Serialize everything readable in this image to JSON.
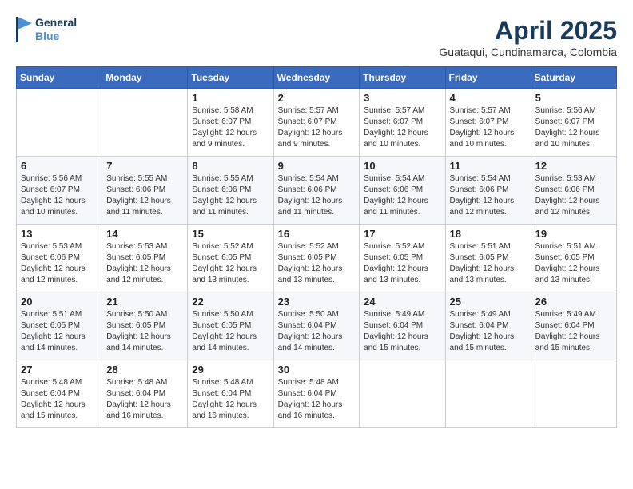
{
  "header": {
    "logo_line1": "General",
    "logo_line2": "Blue",
    "month_year": "April 2025",
    "location": "Guataqui, Cundinamarca, Colombia"
  },
  "weekdays": [
    "Sunday",
    "Monday",
    "Tuesday",
    "Wednesday",
    "Thursday",
    "Friday",
    "Saturday"
  ],
  "weeks": [
    [
      {
        "day": "",
        "sunrise": "",
        "sunset": "",
        "daylight": ""
      },
      {
        "day": "",
        "sunrise": "",
        "sunset": "",
        "daylight": ""
      },
      {
        "day": "1",
        "sunrise": "Sunrise: 5:58 AM",
        "sunset": "Sunset: 6:07 PM",
        "daylight": "Daylight: 12 hours and 9 minutes."
      },
      {
        "day": "2",
        "sunrise": "Sunrise: 5:57 AM",
        "sunset": "Sunset: 6:07 PM",
        "daylight": "Daylight: 12 hours and 9 minutes."
      },
      {
        "day": "3",
        "sunrise": "Sunrise: 5:57 AM",
        "sunset": "Sunset: 6:07 PM",
        "daylight": "Daylight: 12 hours and 10 minutes."
      },
      {
        "day": "4",
        "sunrise": "Sunrise: 5:57 AM",
        "sunset": "Sunset: 6:07 PM",
        "daylight": "Daylight: 12 hours and 10 minutes."
      },
      {
        "day": "5",
        "sunrise": "Sunrise: 5:56 AM",
        "sunset": "Sunset: 6:07 PM",
        "daylight": "Daylight: 12 hours and 10 minutes."
      }
    ],
    [
      {
        "day": "6",
        "sunrise": "Sunrise: 5:56 AM",
        "sunset": "Sunset: 6:07 PM",
        "daylight": "Daylight: 12 hours and 10 minutes."
      },
      {
        "day": "7",
        "sunrise": "Sunrise: 5:55 AM",
        "sunset": "Sunset: 6:06 PM",
        "daylight": "Daylight: 12 hours and 11 minutes."
      },
      {
        "day": "8",
        "sunrise": "Sunrise: 5:55 AM",
        "sunset": "Sunset: 6:06 PM",
        "daylight": "Daylight: 12 hours and 11 minutes."
      },
      {
        "day": "9",
        "sunrise": "Sunrise: 5:54 AM",
        "sunset": "Sunset: 6:06 PM",
        "daylight": "Daylight: 12 hours and 11 minutes."
      },
      {
        "day": "10",
        "sunrise": "Sunrise: 5:54 AM",
        "sunset": "Sunset: 6:06 PM",
        "daylight": "Daylight: 12 hours and 11 minutes."
      },
      {
        "day": "11",
        "sunrise": "Sunrise: 5:54 AM",
        "sunset": "Sunset: 6:06 PM",
        "daylight": "Daylight: 12 hours and 12 minutes."
      },
      {
        "day": "12",
        "sunrise": "Sunrise: 5:53 AM",
        "sunset": "Sunset: 6:06 PM",
        "daylight": "Daylight: 12 hours and 12 minutes."
      }
    ],
    [
      {
        "day": "13",
        "sunrise": "Sunrise: 5:53 AM",
        "sunset": "Sunset: 6:06 PM",
        "daylight": "Daylight: 12 hours and 12 minutes."
      },
      {
        "day": "14",
        "sunrise": "Sunrise: 5:53 AM",
        "sunset": "Sunset: 6:05 PM",
        "daylight": "Daylight: 12 hours and 12 minutes."
      },
      {
        "day": "15",
        "sunrise": "Sunrise: 5:52 AM",
        "sunset": "Sunset: 6:05 PM",
        "daylight": "Daylight: 12 hours and 13 minutes."
      },
      {
        "day": "16",
        "sunrise": "Sunrise: 5:52 AM",
        "sunset": "Sunset: 6:05 PM",
        "daylight": "Daylight: 12 hours and 13 minutes."
      },
      {
        "day": "17",
        "sunrise": "Sunrise: 5:52 AM",
        "sunset": "Sunset: 6:05 PM",
        "daylight": "Daylight: 12 hours and 13 minutes."
      },
      {
        "day": "18",
        "sunrise": "Sunrise: 5:51 AM",
        "sunset": "Sunset: 6:05 PM",
        "daylight": "Daylight: 12 hours and 13 minutes."
      },
      {
        "day": "19",
        "sunrise": "Sunrise: 5:51 AM",
        "sunset": "Sunset: 6:05 PM",
        "daylight": "Daylight: 12 hours and 13 minutes."
      }
    ],
    [
      {
        "day": "20",
        "sunrise": "Sunrise: 5:51 AM",
        "sunset": "Sunset: 6:05 PM",
        "daylight": "Daylight: 12 hours and 14 minutes."
      },
      {
        "day": "21",
        "sunrise": "Sunrise: 5:50 AM",
        "sunset": "Sunset: 6:05 PM",
        "daylight": "Daylight: 12 hours and 14 minutes."
      },
      {
        "day": "22",
        "sunrise": "Sunrise: 5:50 AM",
        "sunset": "Sunset: 6:05 PM",
        "daylight": "Daylight: 12 hours and 14 minutes."
      },
      {
        "day": "23",
        "sunrise": "Sunrise: 5:50 AM",
        "sunset": "Sunset: 6:04 PM",
        "daylight": "Daylight: 12 hours and 14 minutes."
      },
      {
        "day": "24",
        "sunrise": "Sunrise: 5:49 AM",
        "sunset": "Sunset: 6:04 PM",
        "daylight": "Daylight: 12 hours and 15 minutes."
      },
      {
        "day": "25",
        "sunrise": "Sunrise: 5:49 AM",
        "sunset": "Sunset: 6:04 PM",
        "daylight": "Daylight: 12 hours and 15 minutes."
      },
      {
        "day": "26",
        "sunrise": "Sunrise: 5:49 AM",
        "sunset": "Sunset: 6:04 PM",
        "daylight": "Daylight: 12 hours and 15 minutes."
      }
    ],
    [
      {
        "day": "27",
        "sunrise": "Sunrise: 5:48 AM",
        "sunset": "Sunset: 6:04 PM",
        "daylight": "Daylight: 12 hours and 15 minutes."
      },
      {
        "day": "28",
        "sunrise": "Sunrise: 5:48 AM",
        "sunset": "Sunset: 6:04 PM",
        "daylight": "Daylight: 12 hours and 16 minutes."
      },
      {
        "day": "29",
        "sunrise": "Sunrise: 5:48 AM",
        "sunset": "Sunset: 6:04 PM",
        "daylight": "Daylight: 12 hours and 16 minutes."
      },
      {
        "day": "30",
        "sunrise": "Sunrise: 5:48 AM",
        "sunset": "Sunset: 6:04 PM",
        "daylight": "Daylight: 12 hours and 16 minutes."
      },
      {
        "day": "",
        "sunrise": "",
        "sunset": "",
        "daylight": ""
      },
      {
        "day": "",
        "sunrise": "",
        "sunset": "",
        "daylight": ""
      },
      {
        "day": "",
        "sunrise": "",
        "sunset": "",
        "daylight": ""
      }
    ]
  ]
}
